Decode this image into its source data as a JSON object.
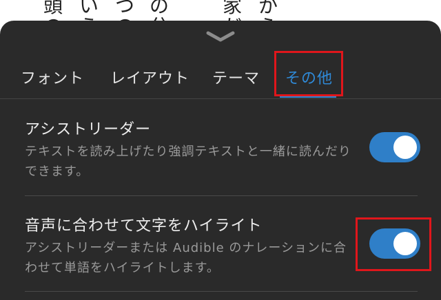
{
  "background_text": {
    "columns": [
      {
        "top": "頭",
        "bottom": "の"
      },
      {
        "top": "い",
        "bottom": "う"
      },
      {
        "top": "つ",
        "bottom": "の"
      },
      {
        "top": "の",
        "bottom": "分"
      },
      {
        "top": "家",
        "bottom": "だ"
      },
      {
        "top": "か",
        "bottom": "ら"
      }
    ]
  },
  "tabs": [
    {
      "label": "フォント",
      "active": false
    },
    {
      "label": "レイアウト",
      "active": false
    },
    {
      "label": "テーマ",
      "active": false
    },
    {
      "label": "その他",
      "active": true
    }
  ],
  "settings": [
    {
      "title": "アシストリーダー",
      "description": "テキストを読み上げたり強調テキストと一緒に読んだりできます。",
      "enabled": true
    },
    {
      "title": "音声に合わせて文字をハイライト",
      "description": "アシストリーダーまたは Audible のナレーションに合わせて単語をハイライトします。",
      "enabled": true
    }
  ],
  "colors": {
    "sheet_background": "#2a2a2a",
    "accent": "#2f8ad8",
    "annotation": "#e0161b"
  }
}
